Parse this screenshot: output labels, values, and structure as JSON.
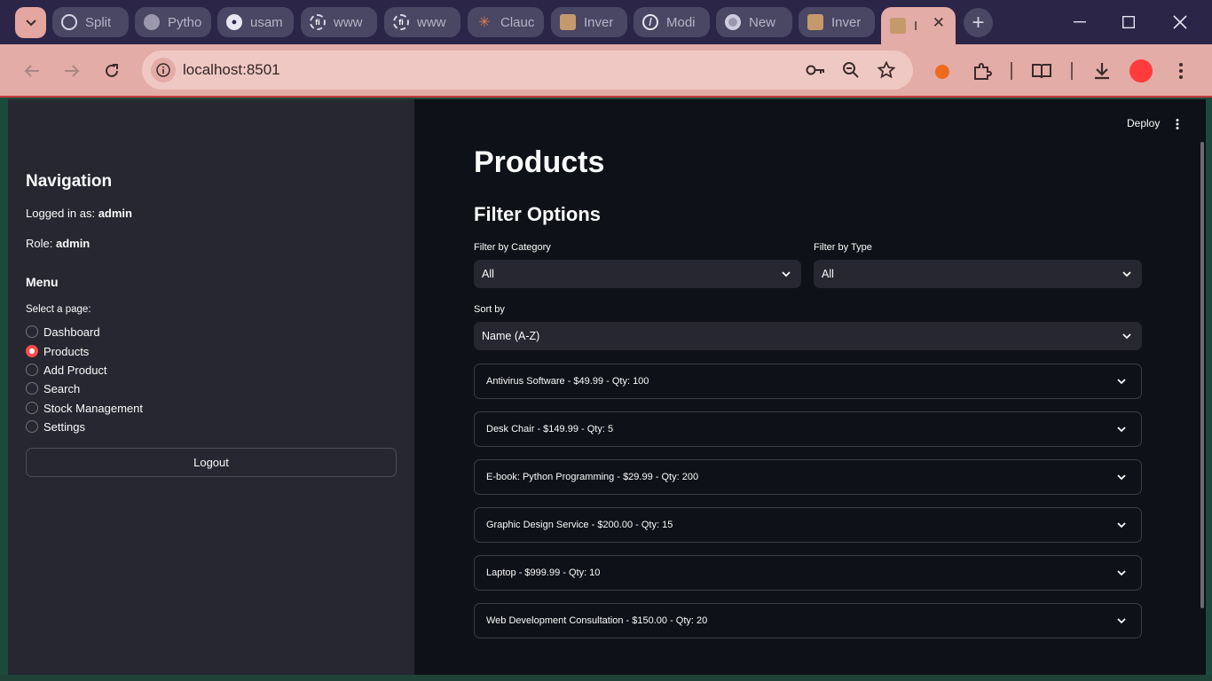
{
  "browser": {
    "tabs": [
      {
        "title": "Split",
        "icon": "openai-icon"
      },
      {
        "title": "Pytho",
        "icon": "globe-icon"
      },
      {
        "title": "usam",
        "icon": "github-icon"
      },
      {
        "title": "www",
        "icon": "fi-icon"
      },
      {
        "title": "www",
        "icon": "fi-icon"
      },
      {
        "title": "Clauc",
        "icon": "claude-icon"
      },
      {
        "title": "Inver",
        "icon": "box-icon"
      },
      {
        "title": "Modi",
        "icon": "no-entry-icon"
      },
      {
        "title": "New",
        "icon": "chrome-icon"
      },
      {
        "title": "Inver",
        "icon": "box-icon"
      },
      {
        "title": "I",
        "icon": "box-icon",
        "active": true
      }
    ],
    "url": "localhost:8501",
    "accent": "#e3aca6"
  },
  "sidebar": {
    "title": "Navigation",
    "logged_in_prefix": "Logged in as: ",
    "logged_in_user": "admin",
    "role_prefix": "Role: ",
    "role": "admin",
    "menu_title": "Menu",
    "radio_label": "Select a page:",
    "pages": [
      "Dashboard",
      "Products",
      "Add Product",
      "Search",
      "Stock Management",
      "Settings"
    ],
    "selected_page": "Products",
    "logout_label": "Logout"
  },
  "main": {
    "deploy_label": "Deploy",
    "title": "Products",
    "subtitle": "Filter Options",
    "filter_category_label": "Filter by Category",
    "filter_category_value": "All",
    "filter_type_label": "Filter by Type",
    "filter_type_value": "All",
    "sort_label": "Sort by",
    "sort_value": "Name (A-Z)",
    "products": [
      "Antivirus Software - $49.99 - Qty: 100",
      "Desk Chair - $149.99 - Qty: 5",
      "E-book: Python Programming - $29.99 - Qty: 200",
      "Graphic Design Service - $200.00 - Qty: 15",
      "Laptop - $999.99 - Qty: 10",
      "Web Development Consultation - $150.00 - Qty: 20"
    ]
  }
}
